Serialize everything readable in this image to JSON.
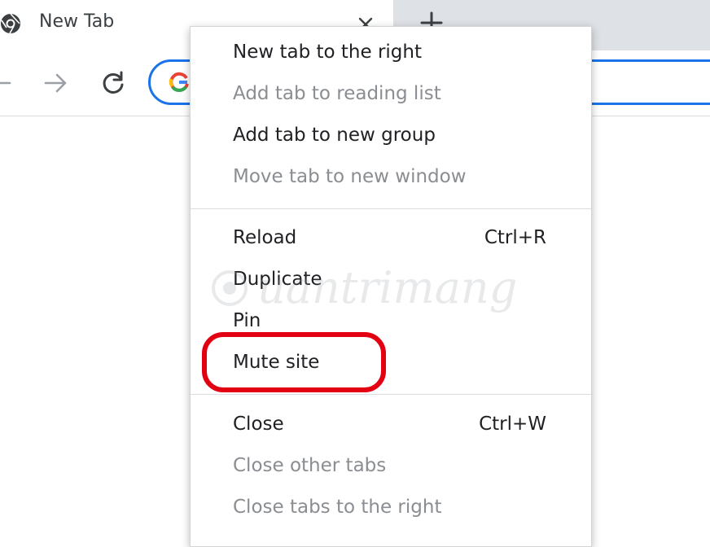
{
  "tab": {
    "title": "New Tab",
    "favicon": "chrome-icon",
    "close_icon": "close-icon"
  },
  "new_tab_button": {
    "icon": "plus-icon"
  },
  "toolbar": {
    "back_icon": "back-arrow-icon",
    "forward_icon": "forward-arrow-icon",
    "reload_icon": "reload-icon",
    "omnibox_icon": "google-g-icon",
    "accent_color": "#1a73e8"
  },
  "context_menu": {
    "groups": [
      [
        {
          "label": "New tab to the right",
          "shortcut": "",
          "enabled": true
        },
        {
          "label": "Add tab to reading list",
          "shortcut": "",
          "enabled": false
        },
        {
          "label": "Add tab to new group",
          "shortcut": "",
          "enabled": true
        },
        {
          "label": "Move tab to new window",
          "shortcut": "",
          "enabled": false
        }
      ],
      [
        {
          "label": "Reload",
          "shortcut": "Ctrl+R",
          "enabled": true
        },
        {
          "label": "Duplicate",
          "shortcut": "",
          "enabled": true
        },
        {
          "label": "Pin",
          "shortcut": "",
          "enabled": true
        },
        {
          "label": "Mute site",
          "shortcut": "",
          "enabled": true
        }
      ],
      [
        {
          "label": "Close",
          "shortcut": "Ctrl+W",
          "enabled": true
        },
        {
          "label": "Close other tabs",
          "shortcut": "",
          "enabled": false
        },
        {
          "label": "Close tabs to the right",
          "shortcut": "",
          "enabled": false
        }
      ]
    ]
  },
  "annotation": {
    "highlight_color": "#e30012",
    "target": "Mute site"
  },
  "watermark": {
    "text": "uantrimang"
  }
}
